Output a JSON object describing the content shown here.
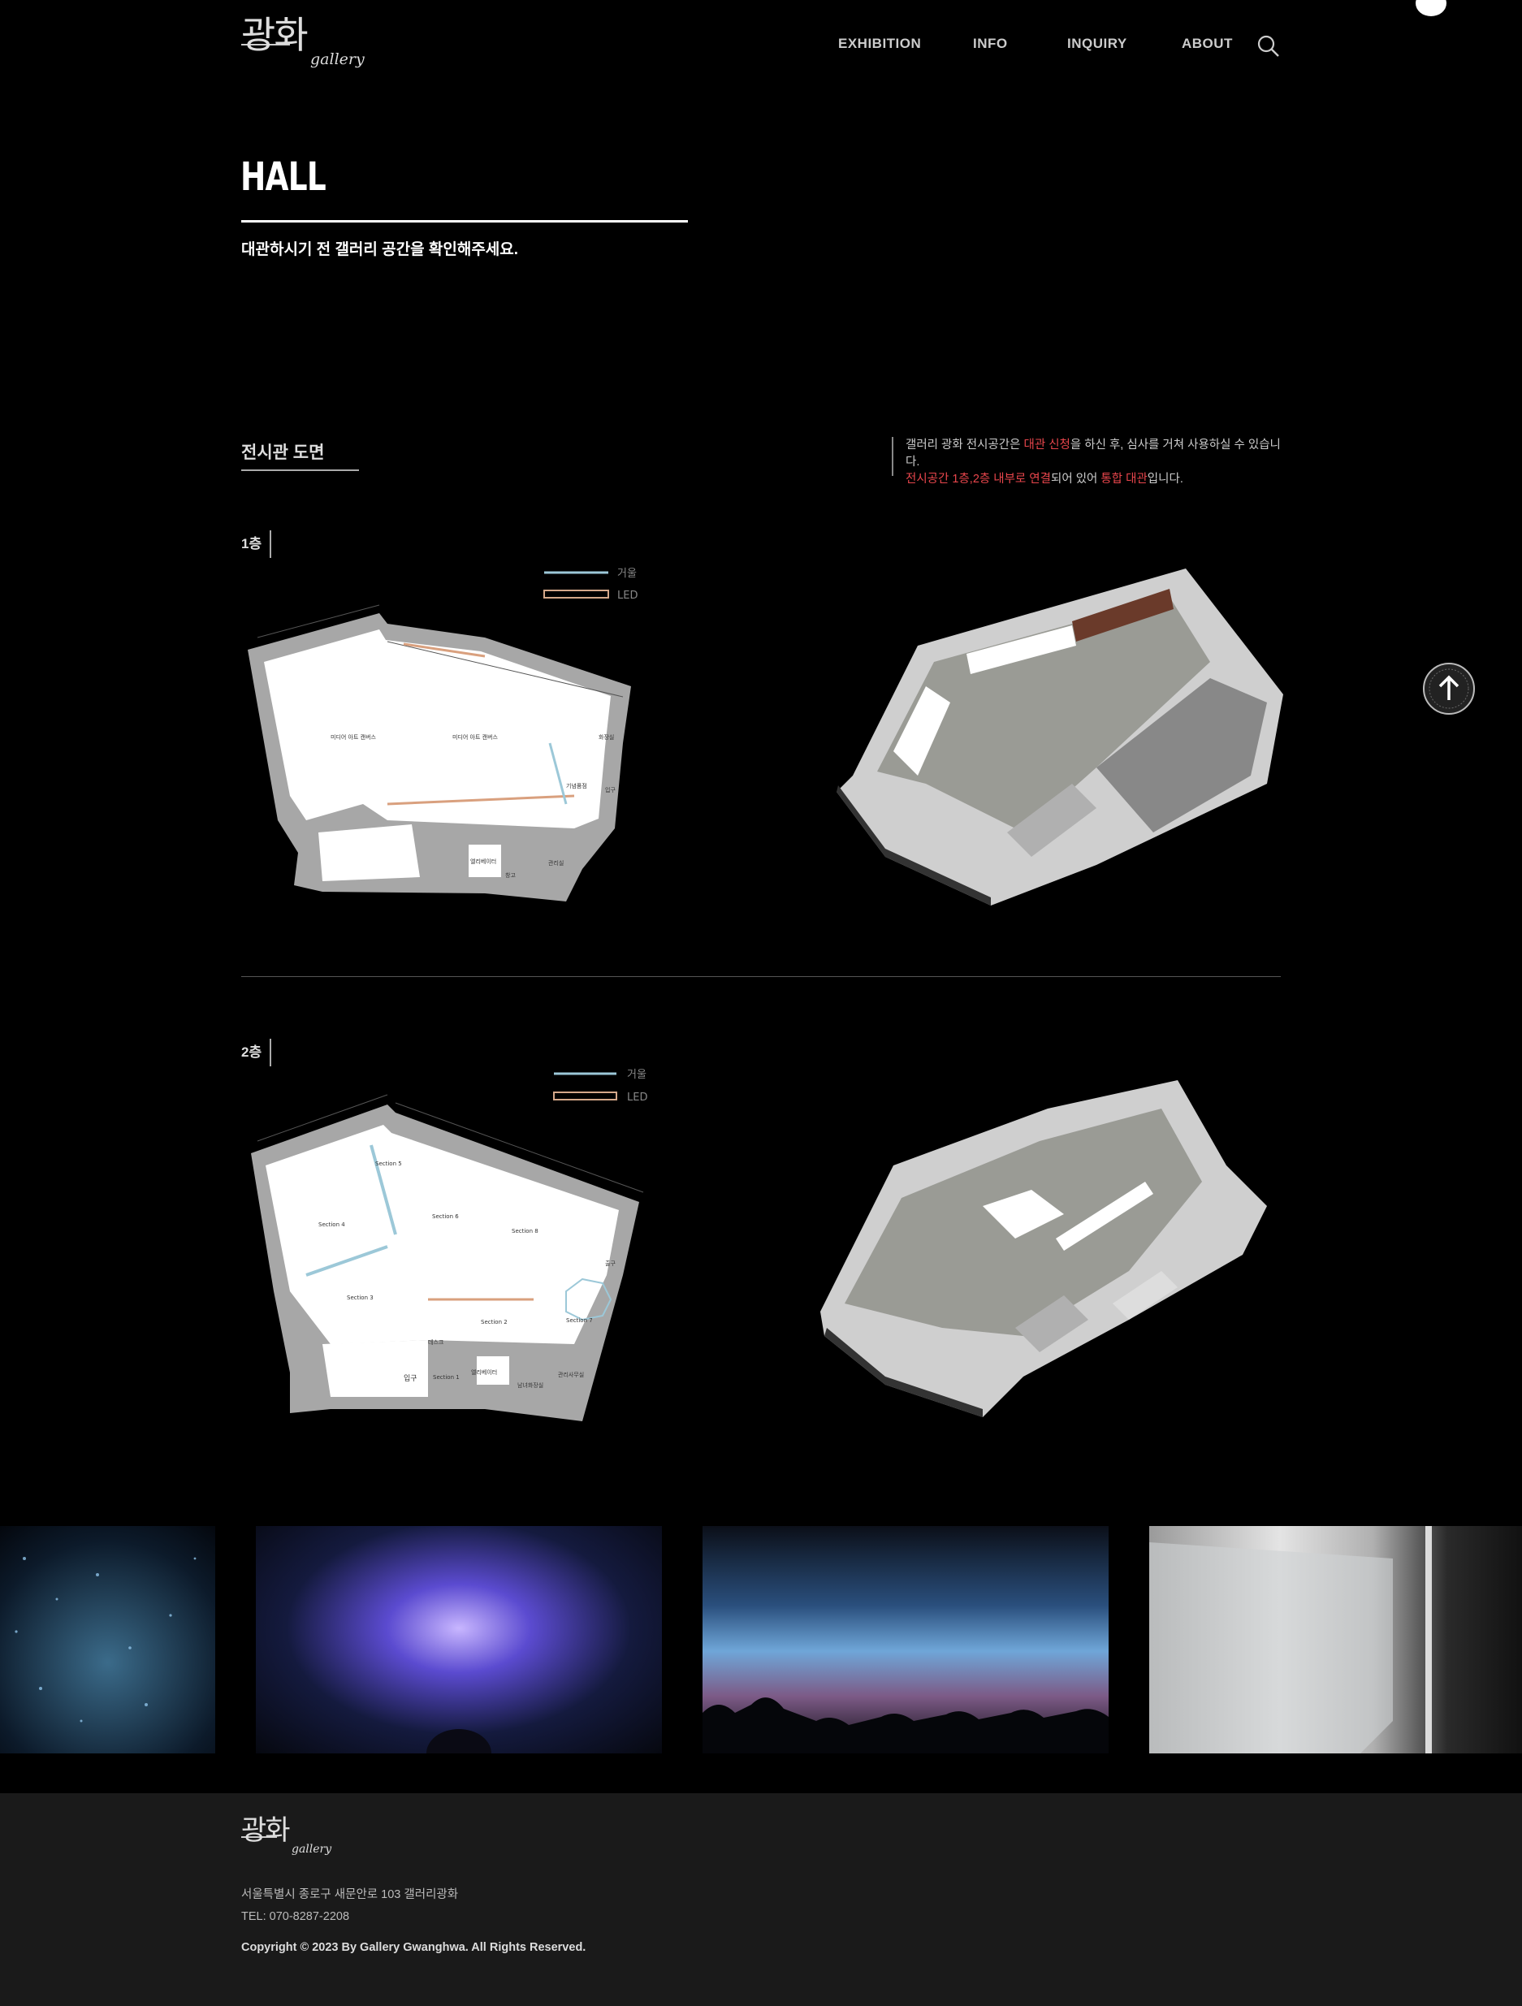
{
  "header": {
    "logo": {
      "korean": "광화",
      "english": "gallery"
    },
    "nav": [
      "EXHIBITION",
      "INFO",
      "INQUIRY",
      "ABOUT"
    ],
    "search_icon": "search-icon"
  },
  "hero": {
    "title": "HALL",
    "subtitle": "대관하시기 전 갤러리 공간을 확인해주세요."
  },
  "floorplan_section": {
    "title": "전시관 도면",
    "notice": {
      "l1_a": "갤러리 광화 전시공간은 ",
      "l1_b": "대관 신청",
      "l1_c": "을 하신 후, 심사를 거쳐 사용하실 수 있습니다.",
      "l2_a": "전시공간 1층,2층 내부로 연결",
      "l2_b": "되어 있어 ",
      "l2_c": "통합 대관",
      "l2_d": "입니다."
    },
    "floors": [
      {
        "label": "1층",
        "legend": [
          "거울",
          "LED"
        ],
        "rooms": [
          "미디어 아트 캔버스",
          "미디어 아트 캔버스",
          "기념품점",
          "화장실",
          "엘리베이터",
          "창고",
          "입구",
          "관리실"
        ]
      },
      {
        "label": "2층",
        "legend": [
          "거울",
          "LED"
        ],
        "rooms": [
          "Section 5",
          "Section 6",
          "Section 4",
          "Section 8",
          "Section 3",
          "Section 2",
          "Section 7",
          "Section 1",
          "출구",
          "입구",
          "엘리베이터",
          "데스크",
          "관리사무실",
          "남녀화장실"
        ]
      }
    ]
  },
  "colors": {
    "accent_red": "#e9464c",
    "background": "#000000",
    "footer_bg": "#1a1a1a"
  },
  "footer": {
    "logo": {
      "korean": "광화",
      "english": "gallery"
    },
    "address": "서울특별시 종로구 새문안로 103 갤러리광화",
    "tel": "TEL: 070-8287-2208",
    "copyright": "Copyright © 2023 By Gallery Gwanghwa. All Rights Reserved."
  },
  "floating": {
    "scroll_top_icon": "arrow-up-icon"
  }
}
